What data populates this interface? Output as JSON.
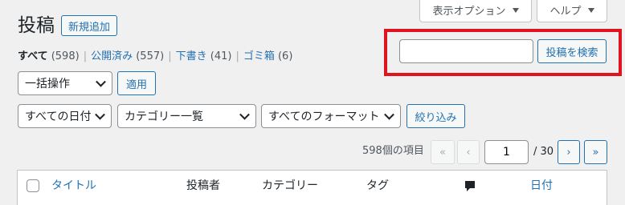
{
  "screen_meta": {
    "options_label": "表示オプション",
    "help_label": "ヘルプ"
  },
  "page": {
    "title": "投稿",
    "add_new_label": "新規追加"
  },
  "views": [
    {
      "label": "すべて",
      "count": "(598)"
    },
    {
      "label": "公開済み",
      "count": "(557)"
    },
    {
      "label": "下書き",
      "count": "(41)"
    },
    {
      "label": "ゴミ箱",
      "count": "(6)"
    }
  ],
  "search": {
    "value": "",
    "button_label": "投稿を検索"
  },
  "bulk": {
    "selected": "一括操作",
    "apply_label": "適用"
  },
  "filters": {
    "date_selected": "すべての日付",
    "category_selected": "カテゴリー一覧",
    "format_selected": "すべてのフォーマット",
    "filter_label": "絞り込み"
  },
  "pagination": {
    "items_text": "598個の項目",
    "first": "«",
    "prev": "‹",
    "current_page": "1",
    "total": "/ 30",
    "next": "›",
    "last": "»"
  },
  "table": {
    "columns": [
      "タイトル",
      "投稿者",
      "カテゴリー",
      "タグ",
      "comments-icon",
      "日付"
    ]
  },
  "colors": {
    "accent": "#2271b1",
    "highlight": "#e0141e"
  }
}
